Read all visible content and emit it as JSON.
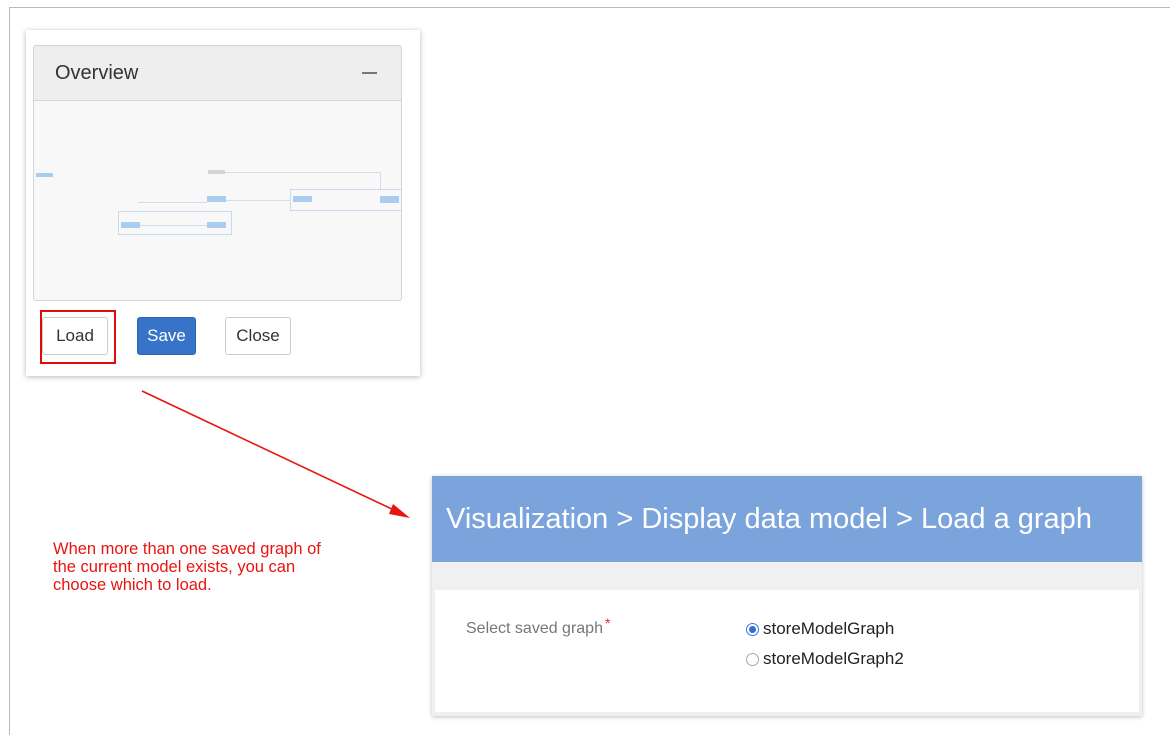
{
  "overview": {
    "title": "Overview",
    "buttons": {
      "load": "Load",
      "save": "Save",
      "close": "Close"
    }
  },
  "annotation": {
    "text": "When more than one saved graph of the current model exists, you can choose which to load.",
    "color": "#e8140f"
  },
  "load_dialog": {
    "breadcrumb": "Visualization > Display data model > Load a graph",
    "field_label": "Select saved graph",
    "required_mark": "*",
    "options": [
      {
        "label": "storeModelGraph",
        "selected": true
      },
      {
        "label": "storeModelGraph2",
        "selected": false
      }
    ],
    "header_color": "#7ba4dc",
    "accent_color": "#3673c9"
  }
}
